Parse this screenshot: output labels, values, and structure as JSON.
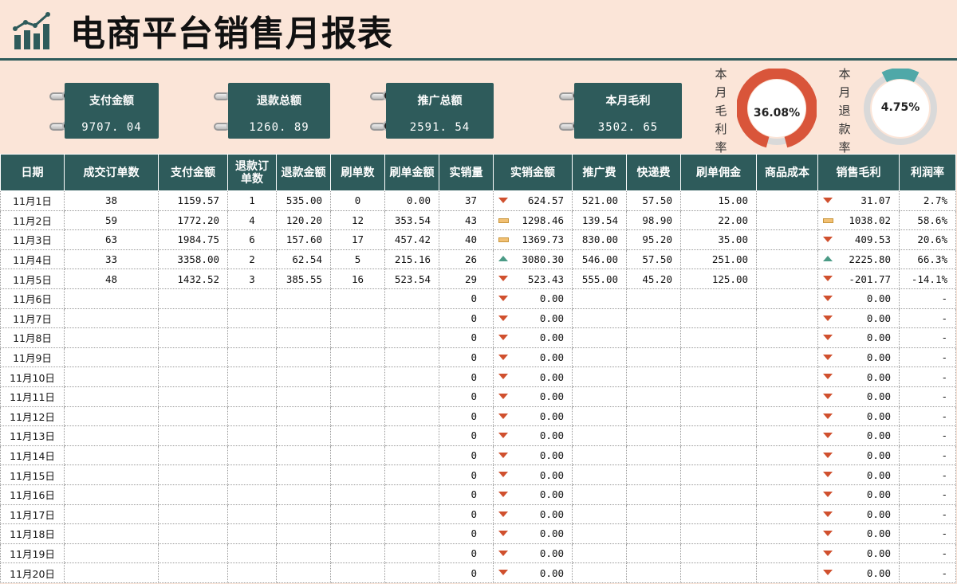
{
  "header": {
    "title": "电商平台销售月报表",
    "logo_icon": "bar-chart-icon"
  },
  "kpis": [
    {
      "label": "支付金额",
      "value": "9707. 04"
    },
    {
      "label": "退款总额",
      "value": "1260. 89"
    },
    {
      "label": "推广总额",
      "value": "2591. 54"
    },
    {
      "label": "本月毛利",
      "value": "3502. 65"
    }
  ],
  "gauges": [
    {
      "label": "本月毛利率",
      "text": "36.08%",
      "value": 36.08,
      "color": "#d9553a"
    },
    {
      "label": "本月退款率",
      "text": "4.75%",
      "value": 4.75,
      "color": "#4fa8a8"
    }
  ],
  "table": {
    "columns": [
      "日期",
      "成交订单数",
      "支付金额",
      "退款订\n单数",
      "退款金额",
      "刷单数",
      "刷单金额",
      "实销量",
      "实销金额",
      "推广费",
      "快递费",
      "刷单佣金",
      "商品成本",
      "销售毛利",
      "利润率"
    ],
    "rows": [
      {
        "date": "11月1日",
        "orders": "38",
        "pay": "1159.57",
        "ref_n": "1",
        "ref_amt": "535.00",
        "brush_n": "0",
        "brush_amt": "0.00",
        "qty": "37",
        "sales_icon": "down",
        "sales": "624.57",
        "promo": "521.00",
        "ship": "57.50",
        "comm": "15.00",
        "cost": "",
        "gp_icon": "down",
        "gp": "31.07",
        "rate": "2.7%"
      },
      {
        "date": "11月2日",
        "orders": "59",
        "pay": "1772.20",
        "ref_n": "4",
        "ref_amt": "120.20",
        "brush_n": "12",
        "brush_amt": "353.54",
        "qty": "43",
        "sales_icon": "flat",
        "sales": "1298.46",
        "promo": "139.54",
        "ship": "98.90",
        "comm": "22.00",
        "cost": "",
        "gp_icon": "flat",
        "gp": "1038.02",
        "rate": "58.6%"
      },
      {
        "date": "11月3日",
        "orders": "63",
        "pay": "1984.75",
        "ref_n": "6",
        "ref_amt": "157.60",
        "brush_n": "17",
        "brush_amt": "457.42",
        "qty": "40",
        "sales_icon": "flat",
        "sales": "1369.73",
        "promo": "830.00",
        "ship": "95.20",
        "comm": "35.00",
        "cost": "",
        "gp_icon": "down",
        "gp": "409.53",
        "rate": "20.6%"
      },
      {
        "date": "11月4日",
        "orders": "33",
        "pay": "3358.00",
        "ref_n": "2",
        "ref_amt": "62.54",
        "brush_n": "5",
        "brush_amt": "215.16",
        "qty": "26",
        "sales_icon": "up",
        "sales": "3080.30",
        "promo": "546.00",
        "ship": "57.50",
        "comm": "251.00",
        "cost": "",
        "gp_icon": "up",
        "gp": "2225.80",
        "rate": "66.3%"
      },
      {
        "date": "11月5日",
        "orders": "48",
        "pay": "1432.52",
        "ref_n": "3",
        "ref_amt": "385.55",
        "brush_n": "16",
        "brush_amt": "523.54",
        "qty": "29",
        "sales_icon": "down",
        "sales": "523.43",
        "promo": "555.00",
        "ship": "45.20",
        "comm": "125.00",
        "cost": "",
        "gp_icon": "down",
        "gp": "-201.77",
        "rate": "-14.1%"
      },
      {
        "date": "11月6日",
        "orders": "",
        "pay": "",
        "ref_n": "",
        "ref_amt": "",
        "brush_n": "",
        "brush_amt": "",
        "qty": "0",
        "sales_icon": "down",
        "sales": "0.00",
        "promo": "",
        "ship": "",
        "comm": "",
        "cost": "",
        "gp_icon": "down",
        "gp": "0.00",
        "rate": "-"
      },
      {
        "date": "11月7日",
        "orders": "",
        "pay": "",
        "ref_n": "",
        "ref_amt": "",
        "brush_n": "",
        "brush_amt": "",
        "qty": "0",
        "sales_icon": "down",
        "sales": "0.00",
        "promo": "",
        "ship": "",
        "comm": "",
        "cost": "",
        "gp_icon": "down",
        "gp": "0.00",
        "rate": "-"
      },
      {
        "date": "11月8日",
        "orders": "",
        "pay": "",
        "ref_n": "",
        "ref_amt": "",
        "brush_n": "",
        "brush_amt": "",
        "qty": "0",
        "sales_icon": "down",
        "sales": "0.00",
        "promo": "",
        "ship": "",
        "comm": "",
        "cost": "",
        "gp_icon": "down",
        "gp": "0.00",
        "rate": "-"
      },
      {
        "date": "11月9日",
        "orders": "",
        "pay": "",
        "ref_n": "",
        "ref_amt": "",
        "brush_n": "",
        "brush_amt": "",
        "qty": "0",
        "sales_icon": "down",
        "sales": "0.00",
        "promo": "",
        "ship": "",
        "comm": "",
        "cost": "",
        "gp_icon": "down",
        "gp": "0.00",
        "rate": "-"
      },
      {
        "date": "11月10日",
        "orders": "",
        "pay": "",
        "ref_n": "",
        "ref_amt": "",
        "brush_n": "",
        "brush_amt": "",
        "qty": "0",
        "sales_icon": "down",
        "sales": "0.00",
        "promo": "",
        "ship": "",
        "comm": "",
        "cost": "",
        "gp_icon": "down",
        "gp": "0.00",
        "rate": "-"
      },
      {
        "date": "11月11日",
        "orders": "",
        "pay": "",
        "ref_n": "",
        "ref_amt": "",
        "brush_n": "",
        "brush_amt": "",
        "qty": "0",
        "sales_icon": "down",
        "sales": "0.00",
        "promo": "",
        "ship": "",
        "comm": "",
        "cost": "",
        "gp_icon": "down",
        "gp": "0.00",
        "rate": "-"
      },
      {
        "date": "11月12日",
        "orders": "",
        "pay": "",
        "ref_n": "",
        "ref_amt": "",
        "brush_n": "",
        "brush_amt": "",
        "qty": "0",
        "sales_icon": "down",
        "sales": "0.00",
        "promo": "",
        "ship": "",
        "comm": "",
        "cost": "",
        "gp_icon": "down",
        "gp": "0.00",
        "rate": "-"
      },
      {
        "date": "11月13日",
        "orders": "",
        "pay": "",
        "ref_n": "",
        "ref_amt": "",
        "brush_n": "",
        "brush_amt": "",
        "qty": "0",
        "sales_icon": "down",
        "sales": "0.00",
        "promo": "",
        "ship": "",
        "comm": "",
        "cost": "",
        "gp_icon": "down",
        "gp": "0.00",
        "rate": "-"
      },
      {
        "date": "11月14日",
        "orders": "",
        "pay": "",
        "ref_n": "",
        "ref_amt": "",
        "brush_n": "",
        "brush_amt": "",
        "qty": "0",
        "sales_icon": "down",
        "sales": "0.00",
        "promo": "",
        "ship": "",
        "comm": "",
        "cost": "",
        "gp_icon": "down",
        "gp": "0.00",
        "rate": "-"
      },
      {
        "date": "11月15日",
        "orders": "",
        "pay": "",
        "ref_n": "",
        "ref_amt": "",
        "brush_n": "",
        "brush_amt": "",
        "qty": "0",
        "sales_icon": "down",
        "sales": "0.00",
        "promo": "",
        "ship": "",
        "comm": "",
        "cost": "",
        "gp_icon": "down",
        "gp": "0.00",
        "rate": "-"
      },
      {
        "date": "11月16日",
        "orders": "",
        "pay": "",
        "ref_n": "",
        "ref_amt": "",
        "brush_n": "",
        "brush_amt": "",
        "qty": "0",
        "sales_icon": "down",
        "sales": "0.00",
        "promo": "",
        "ship": "",
        "comm": "",
        "cost": "",
        "gp_icon": "down",
        "gp": "0.00",
        "rate": "-"
      },
      {
        "date": "11月17日",
        "orders": "",
        "pay": "",
        "ref_n": "",
        "ref_amt": "",
        "brush_n": "",
        "brush_amt": "",
        "qty": "0",
        "sales_icon": "down",
        "sales": "0.00",
        "promo": "",
        "ship": "",
        "comm": "",
        "cost": "",
        "gp_icon": "down",
        "gp": "0.00",
        "rate": "-"
      },
      {
        "date": "11月18日",
        "orders": "",
        "pay": "",
        "ref_n": "",
        "ref_amt": "",
        "brush_n": "",
        "brush_amt": "",
        "qty": "0",
        "sales_icon": "down",
        "sales": "0.00",
        "promo": "",
        "ship": "",
        "comm": "",
        "cost": "",
        "gp_icon": "down",
        "gp": "0.00",
        "rate": "-"
      },
      {
        "date": "11月19日",
        "orders": "",
        "pay": "",
        "ref_n": "",
        "ref_amt": "",
        "brush_n": "",
        "brush_amt": "",
        "qty": "0",
        "sales_icon": "down",
        "sales": "0.00",
        "promo": "",
        "ship": "",
        "comm": "",
        "cost": "",
        "gp_icon": "down",
        "gp": "0.00",
        "rate": "-"
      },
      {
        "date": "11月20日",
        "orders": "",
        "pay": "",
        "ref_n": "",
        "ref_amt": "",
        "brush_n": "",
        "brush_amt": "",
        "qty": "0",
        "sales_icon": "down",
        "sales": "0.00",
        "promo": "",
        "ship": "",
        "comm": "",
        "cost": "",
        "gp_icon": "down",
        "gp": "0.00",
        "rate": "-"
      }
    ]
  }
}
